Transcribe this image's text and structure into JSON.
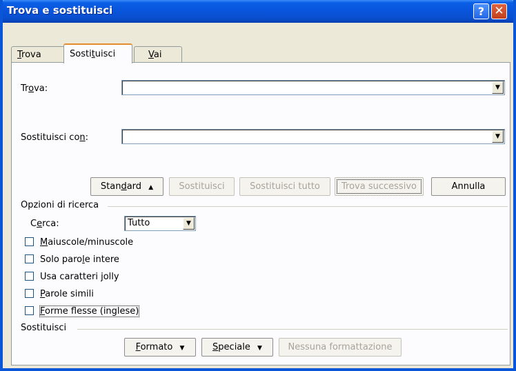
{
  "window": {
    "title": "Trova e sostituisci",
    "help_icon": "question-mark-icon",
    "close_icon": "close-x-icon"
  },
  "tabs": [
    {
      "pre": "",
      "key": "T",
      "post": "rova",
      "active": false
    },
    {
      "pre": "Sosti",
      "key": "t",
      "post": "uisci",
      "active": true
    },
    {
      "pre": "",
      "key": "V",
      "post": "ai",
      "active": false
    }
  ],
  "find": {
    "label_pre": "Tr",
    "label_key": "o",
    "label_post": "va:",
    "value": ""
  },
  "replace": {
    "label_pre": "Sostituisci co",
    "label_key": "n",
    "label_post": ":",
    "value": ""
  },
  "buttons": {
    "standard_pre": "Stan",
    "standard_key": "d",
    "standard_post": "ard",
    "standard_arrow": "▲",
    "replace": "Sostituisci",
    "replace_all": "Sostituisci tutto",
    "find_next": "Trova successivo",
    "cancel": "Annulla"
  },
  "search_options": {
    "group_label": "Opzioni di ricerca",
    "search_label_pre": "C",
    "search_label_key": "e",
    "search_label_post": "rca:",
    "search_value": "Tutto",
    "checkboxes": [
      {
        "pre": "",
        "key": "M",
        "post": "aiuscole/minuscole",
        "checked": false
      },
      {
        "pre": "Solo paro",
        "key": "l",
        "post": "e intere",
        "checked": false
      },
      {
        "pre": "Usa caratteri ",
        "key": "j",
        "post": "olly",
        "checked": false
      },
      {
        "pre": "",
        "key": "P",
        "post": "arole simili",
        "checked": false
      },
      {
        "pre": "",
        "key": "F",
        "post": "orme flesse (inglese)",
        "checked": false
      }
    ]
  },
  "replace_section": {
    "group_label": "Sostituisci",
    "format_pre": "",
    "format_key": "F",
    "format_post": "ormato",
    "special_pre": "",
    "special_key": "S",
    "special_post": "peciale",
    "dropdown_arrow": "▼",
    "no_formatting": "Nessuna formattazione"
  }
}
